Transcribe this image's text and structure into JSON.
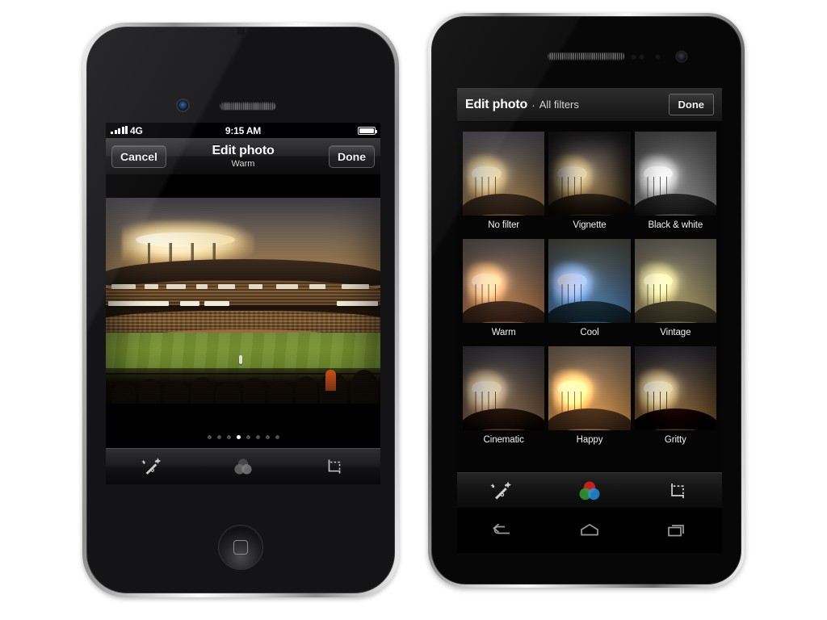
{
  "iphone": {
    "status_bar": {
      "signal": "signal-bars",
      "network": "4G",
      "time": "9:15 AM",
      "battery": "battery-full-icon"
    },
    "nav": {
      "cancel_label": "Cancel",
      "title": "Edit photo",
      "subtitle": "Warm",
      "done_label": "Done"
    },
    "photo": {
      "alt": "Baseball stadium at dusk with floodlights, green field and crowd"
    },
    "pager": {
      "total": 8,
      "active_index": 3
    },
    "toolbar": [
      {
        "name": "magic-wand-icon",
        "label": "Auto enhance",
        "active": false
      },
      {
        "name": "filters-icon",
        "label": "Filters",
        "active": false
      },
      {
        "name": "crop-icon",
        "label": "Crop",
        "active": false
      }
    ],
    "home_button": "home-button"
  },
  "android": {
    "header": {
      "title": "Edit photo",
      "separator": "·",
      "subtitle": "All filters",
      "done_label": "Done"
    },
    "filters": [
      {
        "label": "No filter",
        "key": "f-none"
      },
      {
        "label": "Vignette",
        "key": "f-vig"
      },
      {
        "label": "Black & white",
        "key": "f-bw"
      },
      {
        "label": "Warm",
        "key": "f-warm"
      },
      {
        "label": "Cool",
        "key": "f-cool"
      },
      {
        "label": "Vintage",
        "key": "f-vintage"
      },
      {
        "label": "Cinematic",
        "key": "f-cinematic"
      },
      {
        "label": "Happy",
        "key": "f-happy"
      },
      {
        "label": "Gritty",
        "key": "f-gritty"
      }
    ],
    "toolbar": [
      {
        "name": "magic-wand-icon",
        "label": "Auto enhance",
        "active": false
      },
      {
        "name": "filters-icon",
        "label": "Filters",
        "active": true
      },
      {
        "name": "crop-icon",
        "label": "Crop",
        "active": false
      }
    ],
    "navbar": [
      {
        "name": "back-icon",
        "label": "Back"
      },
      {
        "name": "home-icon",
        "label": "Home"
      },
      {
        "name": "recents-icon",
        "label": "Recent apps"
      }
    ]
  },
  "colors": {
    "filter_icon_red": "#d32020",
    "filter_icon_green": "#33a532",
    "filter_icon_blue": "#2196e8",
    "active_dot": "#ffffff",
    "inactive_dot": "#4f4f4f",
    "screen_black": "#000000",
    "header_grey": "#222222"
  }
}
